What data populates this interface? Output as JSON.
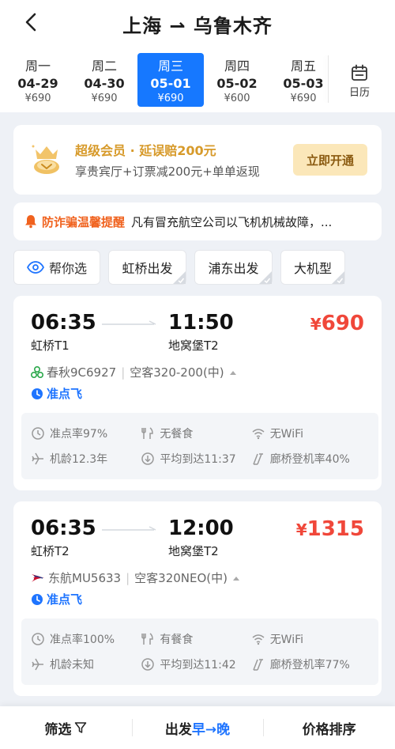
{
  "header": {
    "title": "上海 ⇀ 乌鲁木齐"
  },
  "dates": [
    {
      "weekday": "周一",
      "date": "04-29",
      "price": "¥690",
      "active": false
    },
    {
      "weekday": "周二",
      "date": "04-30",
      "price": "¥690",
      "active": false
    },
    {
      "weekday": "周三",
      "date": "05-01",
      "price": "¥690",
      "active": true
    },
    {
      "weekday": "周四",
      "date": "05-02",
      "price": "¥600",
      "active": false
    },
    {
      "weekday": "周五",
      "date": "05-03",
      "price": "¥690",
      "active": false
    }
  ],
  "calendar": {
    "label": "日历"
  },
  "member": {
    "title": "超级会员 · 延误赔200元",
    "subtitle": "享贵宾厅+订票减200元+单单返现",
    "button": "立即开通"
  },
  "notice": {
    "title": "防诈骗温馨提醒",
    "text": "凡有冒充航空公司以飞机机械故障，..."
  },
  "filters": {
    "help": "帮你选",
    "hongqiao": "虹桥出发",
    "pudong": "浦东出发",
    "large": "大机型"
  },
  "flights": [
    {
      "dep_time": "06:35",
      "dep_airport": "虹桥T1",
      "arr_time": "11:50",
      "arr_airport": "地窝堡T2",
      "price_symbol": "¥",
      "price": "690",
      "airline": "春秋9C6927",
      "aircraft": "空客320-200(中)",
      "ontime_tag": "准点飞",
      "ontime_rate": "准点率97%",
      "meal": "无餐食",
      "wifi": "无WiFi",
      "age": "机龄12.3年",
      "avg_arrival": "平均到达11:37",
      "bridge": "廊桥登机率40%",
      "airline_color": "#2aa84a"
    },
    {
      "dep_time": "06:35",
      "dep_airport": "虹桥T2",
      "arr_time": "12:00",
      "arr_airport": "地窝堡T2",
      "price_symbol": "¥",
      "price": "1315",
      "airline": "东航MU5633",
      "aircraft": "空客320NEO(中)",
      "ontime_tag": "准点飞",
      "ontime_rate": "准点率100%",
      "meal": "有餐食",
      "wifi": "无WiFi",
      "age": "机龄未知",
      "avg_arrival": "平均到达11:42",
      "bridge": "廊桥登机率77%",
      "airline_color": "#c8102e"
    }
  ],
  "bottom_bar": {
    "filter": "筛选",
    "depart_prefix": "出发",
    "depart_order": "早→晚",
    "price_sort": "价格排序"
  },
  "colors": {
    "accent": "#1678ff",
    "price": "#f0473a",
    "member_gold": "#d79a2a",
    "notice_orange": "#f0621e"
  }
}
